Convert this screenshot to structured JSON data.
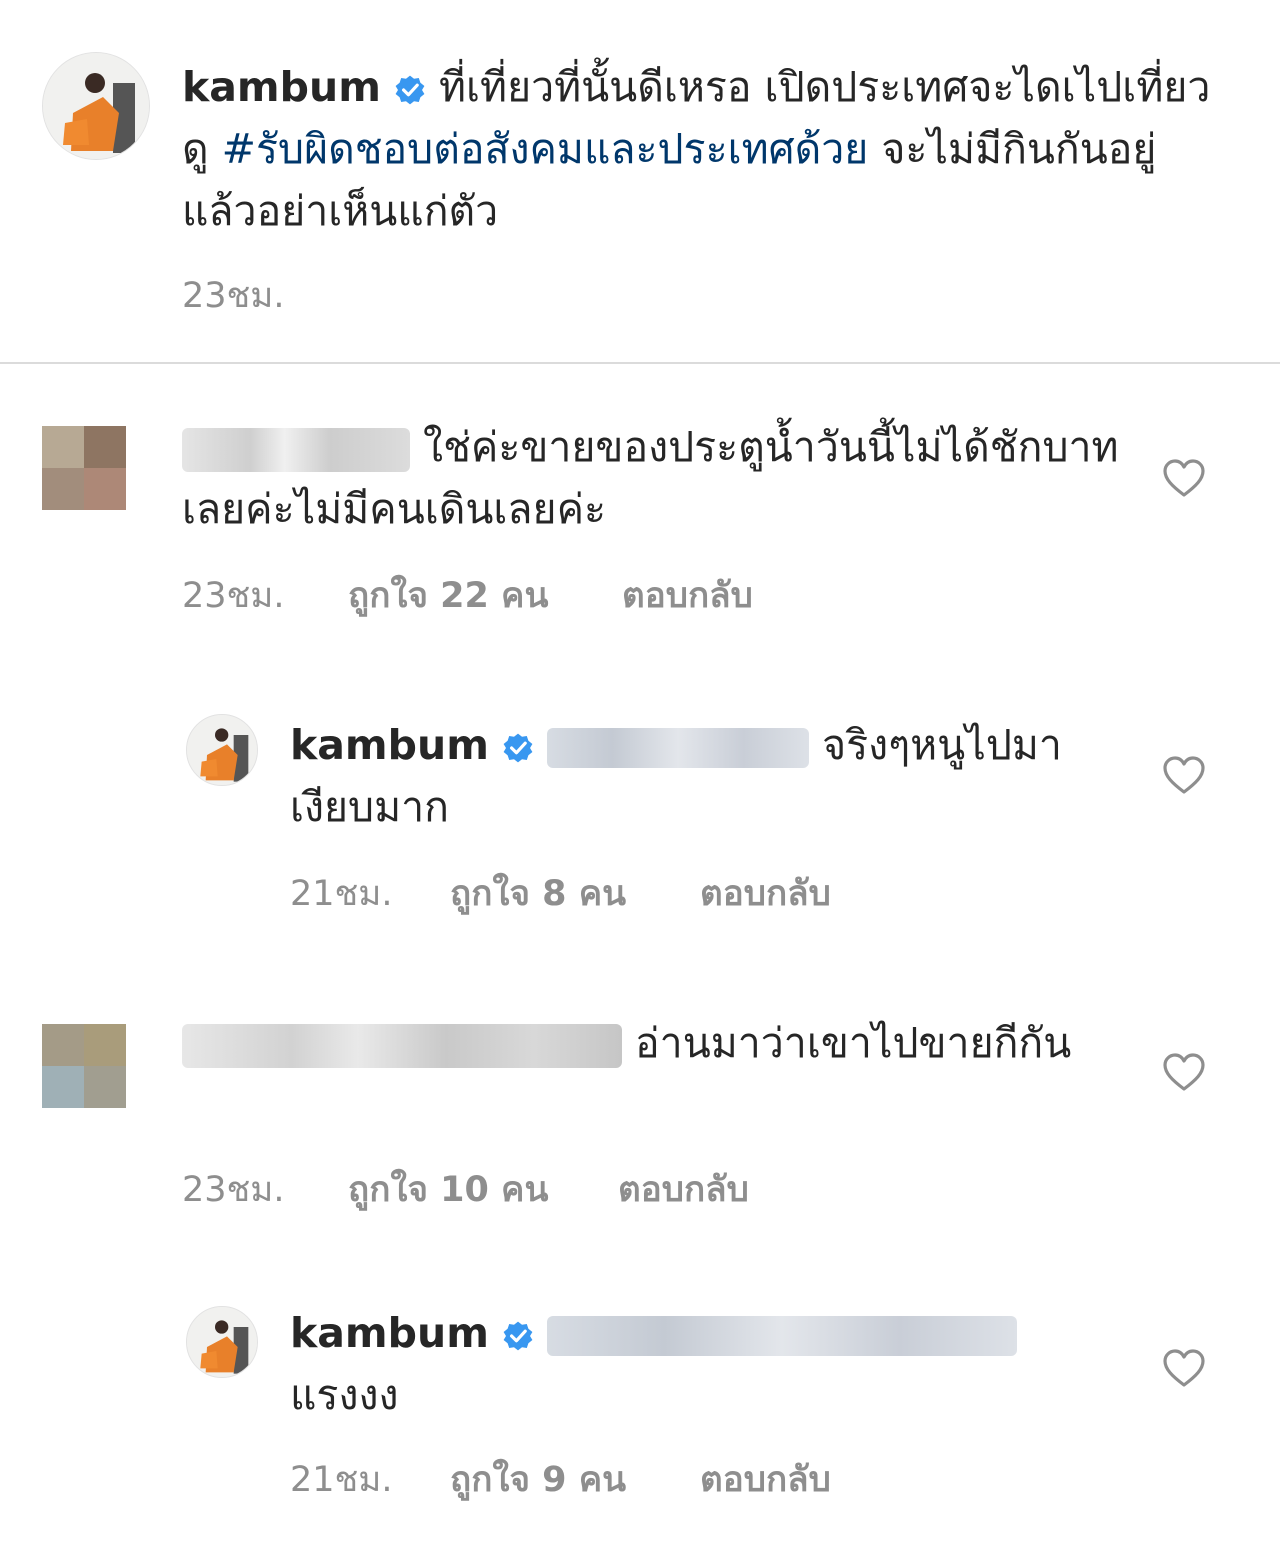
{
  "caption": {
    "username": "kambum",
    "text_1": " ที่เที่ยวที่นั้นดีเหรอ เปิดประเทศจะไดเไปเที่ยวดู ",
    "hashtag": "#รับผิดชอบต่อสังคมและประเทศด้วย",
    "text_2": " จะไม่มีกินกันอยู่แล้วอย่าเห็นแก่ตัว",
    "time": "23ชม."
  },
  "comments": [
    {
      "text": "ใช่ค่ะขายของประตูน้ำวันนี้ไม่ได้ชักบาทเลยค่ะไม่มีคนเดินเลยค่ะ",
      "time": "23ชม.",
      "likes": "ถูกใจ 22 คน",
      "reply": "ตอบกลับ"
    },
    {
      "username": "kambum",
      "text": "จริงๆหนูไปมาเงียบมาก",
      "time": "21ชม.",
      "likes": "ถูกใจ 8 คน",
      "reply": "ตอบกลับ"
    },
    {
      "text": "อ่านมาว่าเขาไปขายกีกัน",
      "time": "23ชม.",
      "likes": "ถูกใจ 10 คน",
      "reply": "ตอบกลับ"
    },
    {
      "username": "kambum",
      "text": "แรงงง",
      "time": "21ชม.",
      "likes": "ถูกใจ 9 คน",
      "reply": "ตอบกลับ"
    }
  ],
  "colors": {
    "text": "#262626",
    "muted": "#8e8e8e",
    "hashtag": "#00376b",
    "verified": "#3897f0",
    "divider": "#dbdbdb",
    "heart": "#8e8e8e"
  },
  "icons": [
    "avatar-photo",
    "verified-badge-icon",
    "heart-icon"
  ]
}
